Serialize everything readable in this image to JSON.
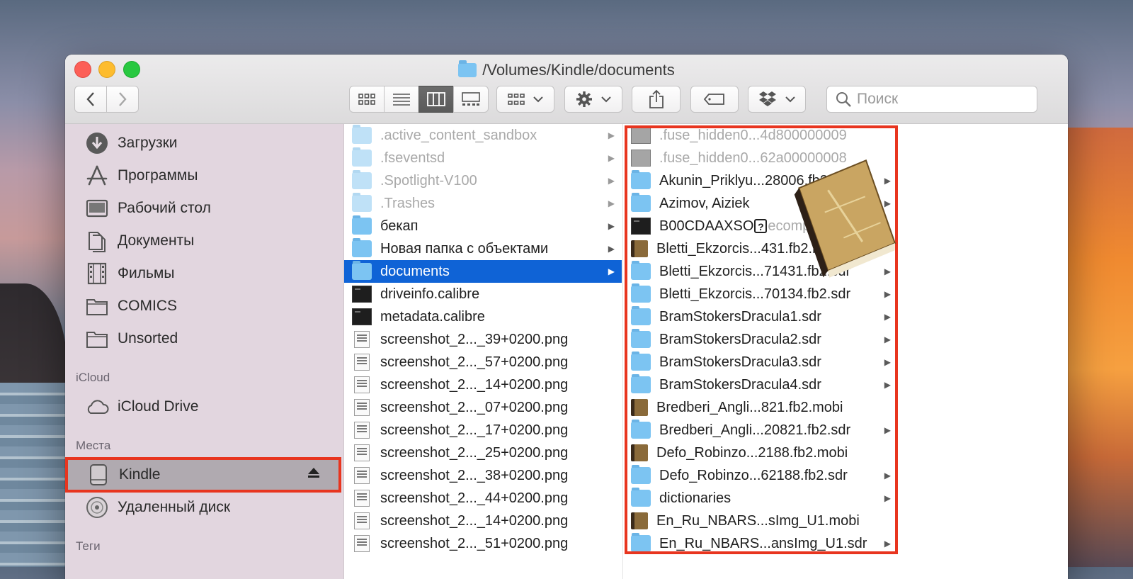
{
  "window": {
    "title": "/Volumes/Kindle/documents"
  },
  "toolbar": {
    "search_placeholder": "Поиск"
  },
  "sidebar": {
    "favorites": [
      {
        "label": "Загрузки",
        "icon": "download-icon"
      },
      {
        "label": "Программы",
        "icon": "applications-icon"
      },
      {
        "label": "Рабочий стол",
        "icon": "desktop-icon"
      },
      {
        "label": "Документы",
        "icon": "documents-icon"
      },
      {
        "label": "Фильмы",
        "icon": "movies-icon"
      },
      {
        "label": "COMICS",
        "icon": "folder-icon"
      },
      {
        "label": "Unsorted",
        "icon": "folder-icon"
      }
    ],
    "icloud_heading": "iCloud",
    "icloud_drive": "iCloud Drive",
    "places_heading": "Места",
    "kindle": "Kindle",
    "remote_disc": "Удаленный диск",
    "tags_heading": "Теги"
  },
  "column2": [
    {
      "name": ".active_content_sandbox",
      "type": "folder",
      "dim": true,
      "arrow": true
    },
    {
      "name": ".fseventsd",
      "type": "folder",
      "dim": true,
      "arrow": true
    },
    {
      "name": ".Spotlight-V100",
      "type": "folder",
      "dim": true,
      "arrow": true
    },
    {
      "name": ".Trashes",
      "type": "folder",
      "dim": true,
      "arrow": true
    },
    {
      "name": "бекап",
      "type": "folder",
      "dim": false,
      "arrow": true
    },
    {
      "name": "Новая папка с объектами",
      "type": "folder",
      "dim": false,
      "arrow": true
    },
    {
      "name": "documents",
      "type": "folder",
      "dim": false,
      "arrow": true,
      "selected": true
    },
    {
      "name": "driveinfo.calibre",
      "type": "exec",
      "dim": false,
      "arrow": false
    },
    {
      "name": "metadata.calibre",
      "type": "exec",
      "dim": false,
      "arrow": false
    },
    {
      "name": "screenshot_2..._39+0200.png",
      "type": "png",
      "dim": false,
      "arrow": false
    },
    {
      "name": "screenshot_2..._57+0200.png",
      "type": "png",
      "dim": false,
      "arrow": false
    },
    {
      "name": "screenshot_2..._14+0200.png",
      "type": "png",
      "dim": false,
      "arrow": false
    },
    {
      "name": "screenshot_2..._07+0200.png",
      "type": "png",
      "dim": false,
      "arrow": false
    },
    {
      "name": "screenshot_2..._17+0200.png",
      "type": "png",
      "dim": false,
      "arrow": false
    },
    {
      "name": "screenshot_2..._25+0200.png",
      "type": "png",
      "dim": false,
      "arrow": false
    },
    {
      "name": "screenshot_2..._38+0200.png",
      "type": "png",
      "dim": false,
      "arrow": false
    },
    {
      "name": "screenshot_2..._44+0200.png",
      "type": "png",
      "dim": false,
      "arrow": false
    },
    {
      "name": "screenshot_2..._14+0200.png",
      "type": "png",
      "dim": false,
      "arrow": false
    },
    {
      "name": "screenshot_2..._51+0200.png",
      "type": "png",
      "dim": false,
      "arrow": false
    }
  ],
  "column3": [
    {
      "name": ".fuse_hidden0...4d800000009",
      "type": "gray",
      "dim": true,
      "arrow": false
    },
    {
      "name": ".fuse_hidden0...62a00000008",
      "type": "gray",
      "dim": true,
      "arrow": false
    },
    {
      "name": "Akunin_Priklyu...28006.fb2.sdr",
      "type": "folder",
      "dim": false,
      "arrow": true
    },
    {
      "name": "Azimov, Aiziek",
      "type": "folder",
      "dim": false,
      "arrow": true
    },
    {
      "name": "B00CDAAXSO",
      "suffix": "ecompressed",
      "type": "exec",
      "dim": false,
      "arrow": false,
      "qmark": true
    },
    {
      "name": "Bletti_Ekzorcis...431.fb2.mobi",
      "type": "book",
      "dim": false,
      "arrow": false
    },
    {
      "name": "Bletti_Ekzorcis...71431.fb2.sdr",
      "type": "folder",
      "dim": false,
      "arrow": true
    },
    {
      "name": "Bletti_Ekzorcis...70134.fb2.sdr",
      "type": "folder",
      "dim": false,
      "arrow": true
    },
    {
      "name": "BramStokersDracula1.sdr",
      "type": "folder",
      "dim": false,
      "arrow": true
    },
    {
      "name": "BramStokersDracula2.sdr",
      "type": "folder",
      "dim": false,
      "arrow": true
    },
    {
      "name": "BramStokersDracula3.sdr",
      "type": "folder",
      "dim": false,
      "arrow": true
    },
    {
      "name": "BramStokersDracula4.sdr",
      "type": "folder",
      "dim": false,
      "arrow": true
    },
    {
      "name": "Bredberi_Angli...821.fb2.mobi",
      "type": "book",
      "dim": false,
      "arrow": false
    },
    {
      "name": "Bredberi_Angli...20821.fb2.sdr",
      "type": "folder",
      "dim": false,
      "arrow": true
    },
    {
      "name": "Defo_Robinzo...2188.fb2.mobi",
      "type": "book",
      "dim": false,
      "arrow": false
    },
    {
      "name": "Defo_Robinzo...62188.fb2.sdr",
      "type": "folder",
      "dim": false,
      "arrow": true
    },
    {
      "name": "dictionaries",
      "type": "folder",
      "dim": false,
      "arrow": true
    },
    {
      "name": "En_Ru_NBARS...sImg_U1.mobi",
      "type": "book",
      "dim": false,
      "arrow": false
    },
    {
      "name": "En_Ru_NBARS...ansImg_U1.sdr",
      "type": "folder",
      "dim": false,
      "arrow": true
    }
  ],
  "colors": {
    "selection": "#0f63d6",
    "highlight_frame": "#e8351f",
    "folder": "#7cc4f2"
  }
}
